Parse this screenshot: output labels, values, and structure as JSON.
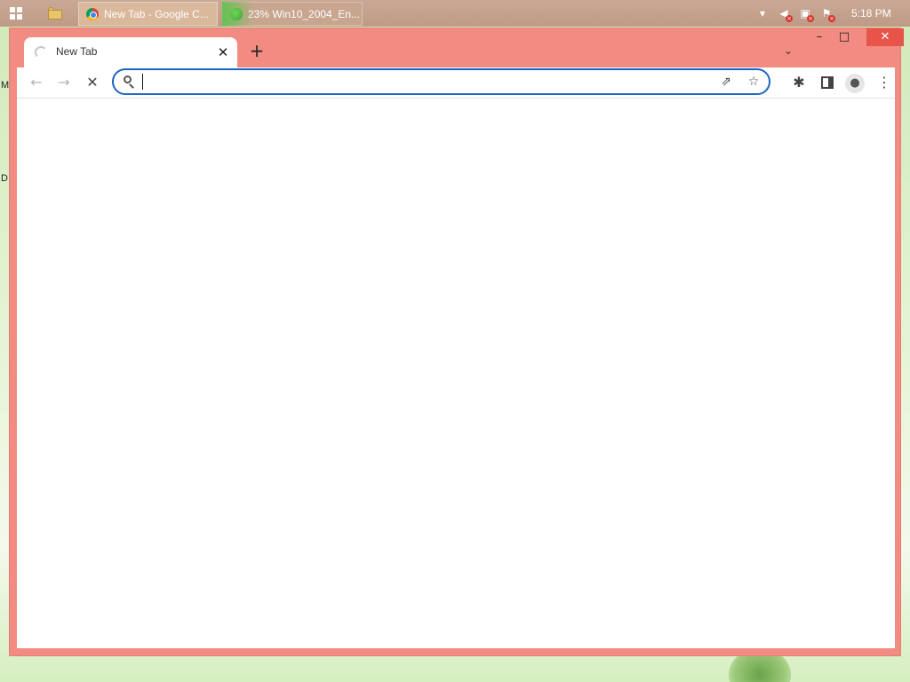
{
  "desktop": {
    "fragments": [
      "M",
      "D"
    ]
  },
  "taskbar": {
    "start_icon": "windows-icon",
    "explorer_icon": "folder-icon",
    "tasks": [
      {
        "label": "New Tab - Google C...",
        "icon": "chrome-icon",
        "active": true
      },
      {
        "label": "23% Win10_2004_En...",
        "icon": "download-manager-icon",
        "progress_percent": 23
      }
    ],
    "tray": {
      "icons": [
        "chevron-up-icon",
        "speaker-muted-icon",
        "network-error-icon",
        "flag-error-icon"
      ],
      "time": "5:18 PM"
    }
  },
  "browser": {
    "window_controls": {
      "minimize": "–",
      "maximize": "□",
      "close": "✕"
    },
    "tab_dropdown": "⌄",
    "tabs": [
      {
        "title": "New Tab",
        "loading": true,
        "close": "✕"
      }
    ],
    "new_tab": "+",
    "toolbar": {
      "back": "←",
      "forward": "→",
      "stop": "✕",
      "omnibox": {
        "value": "",
        "placeholder": ""
      },
      "share": "⇗",
      "bookmark": "☆",
      "extensions": "✱",
      "menu": "⋮",
      "profile": "●"
    },
    "colors": {
      "frame": "#f28b82",
      "focus_ring": "#1a66c2",
      "taskbar": "#c9a895"
    }
  }
}
